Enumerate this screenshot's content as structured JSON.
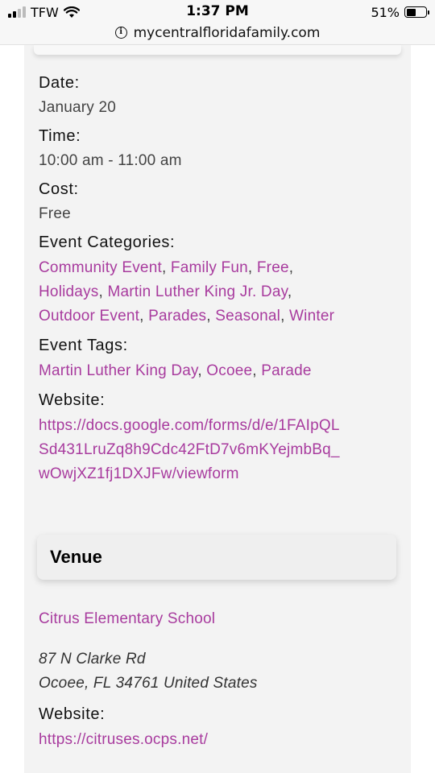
{
  "status_bar": {
    "carrier": "TFW",
    "time": "1:37 PM",
    "battery_percent": "51%"
  },
  "browser": {
    "url": "mycentralfloridafamily.com"
  },
  "event": {
    "date_label": "Date:",
    "date_value": "January 20",
    "time_label": "Time:",
    "time_value": "10:00 am - 11:00 am",
    "cost_label": "Cost:",
    "cost_value": "Free",
    "categories_label": "Event Categories:",
    "categories": [
      "Community Event",
      "Family Fun",
      "Free",
      "Holidays",
      "Martin Luther King Jr. Day",
      "Outdoor Event",
      "Parades",
      "Seasonal",
      "Winter"
    ],
    "tags_label": "Event Tags:",
    "tags": [
      "Martin Luther King Day",
      "Ocoee",
      "Parade"
    ],
    "website_label": "Website:",
    "website_lines": [
      "https://docs.google.com/forms/d/e/1FAIpQL",
      "Sd431LruZq8h9Cdc42FtD7v6mKYejmbBq_",
      "wOwjXZ1fj1DXJFw/viewform"
    ]
  },
  "venue": {
    "heading": "Venue",
    "name": "Citrus Elementary School",
    "address_line1": "87 N Clarke Rd",
    "address_line2": "Ocoee, FL 34761 United States",
    "website_label": "Website:",
    "website": "https://citruses.ocps.net/"
  },
  "colors": {
    "link": "#a83b9e",
    "card_bg": "#f3f3f3"
  }
}
